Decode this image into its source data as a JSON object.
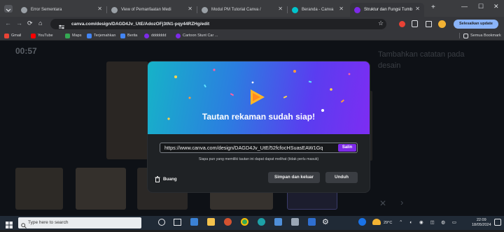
{
  "browser": {
    "tabs": [
      {
        "label": "Error Sementara",
        "favicon_color": "#9aa0a6",
        "active": false
      },
      {
        "label": "View of Pemanfaatan Medi",
        "favicon_color": "#9aa0a6",
        "active": false
      },
      {
        "label": "Modul PM Tutorial Canva /",
        "favicon_color": "#9aa0a6",
        "active": false
      },
      {
        "label": "Beranda - Canva",
        "favicon_color": "#00c4cc",
        "active": false
      },
      {
        "label": "Struktur dan Fungsi Tumb",
        "favicon_color": "#7d2ae8",
        "active": true
      }
    ],
    "new_tab": "+",
    "window_controls": {
      "minimize": "—",
      "maximize": "☐",
      "close": "✕"
    },
    "url": "canva.com/design/DAGD4Jv_UtE/AdozOFj3tN1-pqy44RZHg/edit",
    "update_button": "Selesaikan update",
    "bookmarks": [
      {
        "label": "Gmail",
        "color": "#ea4335"
      },
      {
        "label": "YouTube",
        "color": "#ff0000"
      },
      {
        "label": "Maps",
        "color": "#34a853"
      },
      {
        "label": "Terjemahkan",
        "color": "#4285f4"
      },
      {
        "label": "Berita",
        "color": "#4285f4"
      },
      {
        "label": "ddddddd",
        "color": "#7d2ae8"
      },
      {
        "label": "Cartoon Stunt Car ...",
        "color": "#7d2ae8"
      }
    ],
    "all_bookmarks": "Semua Bookmark"
  },
  "canva": {
    "timer": "00:57",
    "notes_placeholder": "Tambahkan catatan pada desain"
  },
  "modal": {
    "title": "Tautan rekaman sudah siap!",
    "link": "https://www.canva.com/design/DAGD4Jv_UtE/52fcfocHSuasEAW1Gq",
    "copy_label": "Salin",
    "note": "Siapa pun yang memiliki tautan ini dapat dapat melihat (tidak perlu masuk)",
    "delete_label": "Buang",
    "save_exit_label": "Simpan dan keluar",
    "download_label": "Unduh"
  },
  "taskbar": {
    "search_placeholder": "Type here to search",
    "weather": "29°C",
    "time": "22:09",
    "date": "18/05/2024"
  },
  "colors": {
    "accent": "#7d2ae8",
    "hero_start": "#16b3c8",
    "hero_end": "#7d2df2"
  }
}
